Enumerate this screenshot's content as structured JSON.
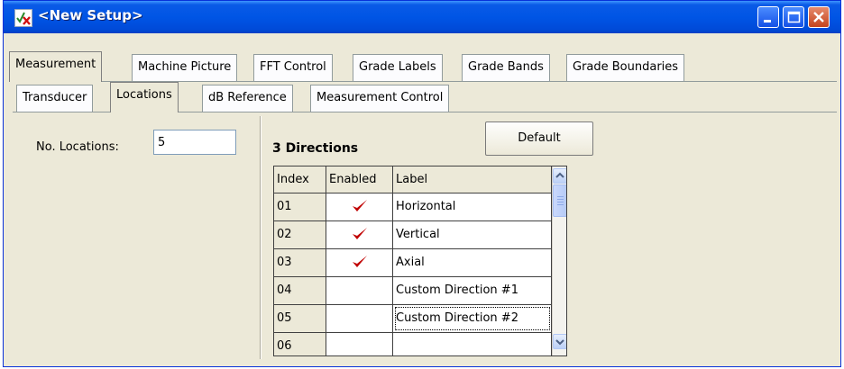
{
  "window": {
    "title": "<New Setup>"
  },
  "main_tabs": [
    "Measurement",
    "Machine Picture",
    "FFT Control",
    "Grade Labels",
    "Grade Bands",
    "Grade Boundaries"
  ],
  "sub_tabs": [
    "Transducer",
    "Locations",
    "dB Reference",
    "Measurement Control"
  ],
  "locations": {
    "label": "No. Locations:",
    "value": "5"
  },
  "directions": {
    "title": "3 Directions",
    "default_button": "Default",
    "columns": [
      "Index",
      "Enabled",
      "Label"
    ],
    "rows": [
      {
        "index": "01",
        "enabled": true,
        "label": "Horizontal"
      },
      {
        "index": "02",
        "enabled": true,
        "label": "Vertical"
      },
      {
        "index": "03",
        "enabled": true,
        "label": "Axial"
      },
      {
        "index": "04",
        "enabled": false,
        "label": "Custom Direction #1"
      },
      {
        "index": "05",
        "enabled": false,
        "label": "Custom Direction #2"
      },
      {
        "index": "06",
        "enabled": false,
        "label": ""
      }
    ]
  },
  "colors": {
    "titlebar": "#0055e5",
    "check": "#c00000",
    "face": "#ece9d8"
  }
}
